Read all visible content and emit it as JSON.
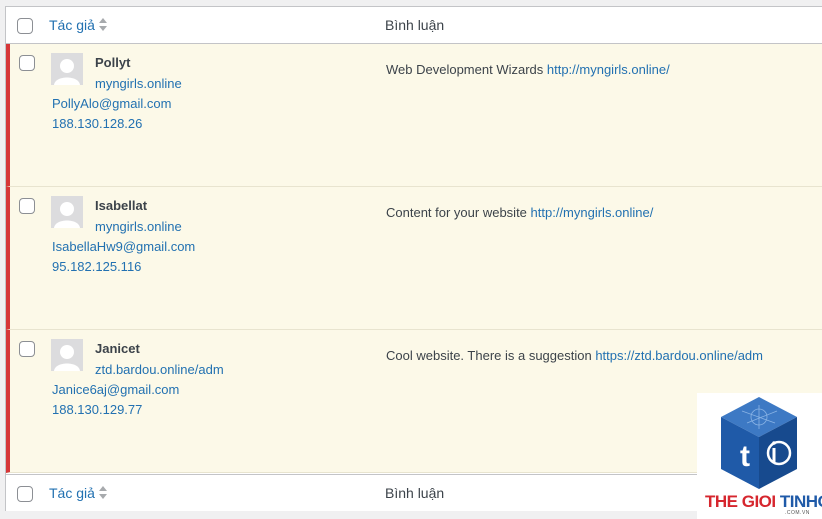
{
  "columns": {
    "author": "Tác giả",
    "comment": "Bình luận"
  },
  "comments": [
    {
      "name": "Pollyt",
      "site": "myngirls.online",
      "email": "PollyAlo@gmail.com",
      "ip": "188.130.128.26",
      "text": "Web Development Wizards ",
      "link": "http://myngirls.online/"
    },
    {
      "name": "Isabellat",
      "site": "myngirls.online",
      "email": "IsabellaHw9@gmail.com",
      "ip": "95.182.125.116",
      "text": "Content for your website ",
      "link": "http://myngirls.online/"
    },
    {
      "name": "Janicet",
      "site": "ztd.bardou.online/adm",
      "email": "Janice6aj@gmail.com",
      "ip": "188.130.129.77",
      "text": "Cool website. There is a suggestion ",
      "link": "https://ztd.bardou.online/adm"
    }
  ],
  "watermark": {
    "word1": "THE GIOI ",
    "word2": "TINHOC",
    "sub": ".COM.VN",
    "logo_letter": "t"
  },
  "colors": {
    "link": "#2271b1",
    "unapproved_bg": "#fcf9e8",
    "unapproved_border": "#d63638",
    "logo_blue": "#1f5aa8",
    "logo_red": "#d6262e"
  }
}
